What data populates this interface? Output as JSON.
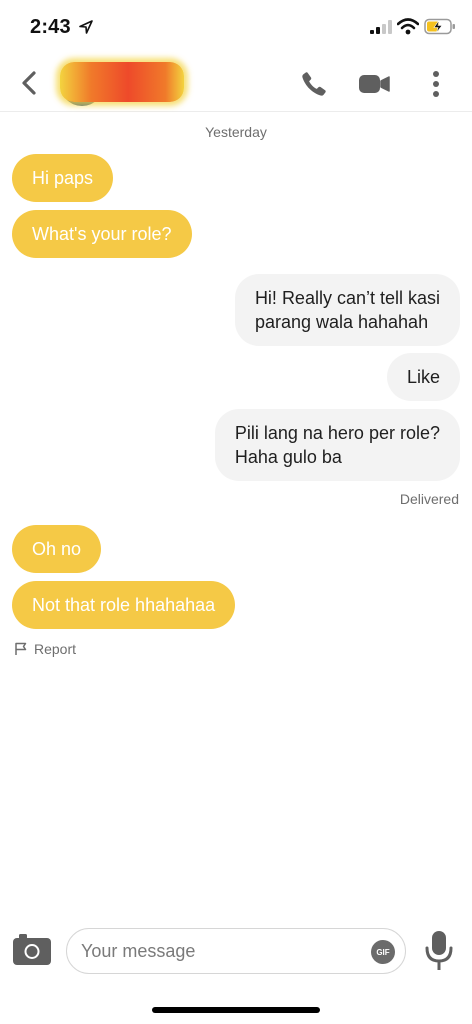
{
  "status_bar": {
    "time": "2:43"
  },
  "header": {
    "contact_name_redacted": true,
    "icons": [
      "back-arrow-icon",
      "phone-icon",
      "video-camera-icon",
      "more-vertical-icon"
    ]
  },
  "thread": {
    "date_separator": "Yesterday",
    "messages": [
      {
        "from": "them",
        "text": "Hi paps"
      },
      {
        "from": "them",
        "text": "What's your role?"
      },
      {
        "from": "me",
        "lines": [
          "Hi! Really can’t tell kasi",
          "parang wala hahahah"
        ]
      },
      {
        "from": "me",
        "text": "Like"
      },
      {
        "from": "me",
        "lines": [
          "Pili lang na hero per role?",
          "Haha gulo ba"
        ]
      },
      {
        "from": "them",
        "text": "Oh no"
      },
      {
        "from": "them",
        "text": "Not that role hhahahaa"
      }
    ],
    "delivered_label": "Delivered",
    "report_label": "Report"
  },
  "composer": {
    "placeholder": "Your message",
    "value": "",
    "gif_label": "GIF"
  },
  "colors": {
    "incoming_bubble": "#f5c946",
    "outgoing_bubble": "#f3f3f3",
    "icon_gray": "#5f5f5f"
  }
}
